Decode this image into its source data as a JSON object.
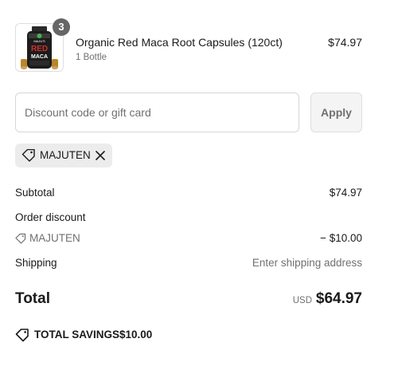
{
  "product": {
    "name": "Organic Red Maca Root Capsules (120ct)",
    "variant": "1 Bottle",
    "price": "$74.97",
    "quantity": "3",
    "image_icon": "supplement-bottle",
    "image_brand": "MAJU'S",
    "image_title_top": "RED",
    "image_title_bottom": "MACA"
  },
  "discount": {
    "placeholder": "Discount code or gift card",
    "value": "",
    "apply_label": "Apply"
  },
  "applied_code": {
    "code": "MAJUTEN",
    "icon": "tag-icon",
    "remove_icon": "close-icon"
  },
  "summary": {
    "subtotal_label": "Subtotal",
    "subtotal_value": "$74.97",
    "order_discount_label": "Order discount",
    "discount_code": "MAJUTEN",
    "discount_value": "− $10.00",
    "shipping_label": "Shipping",
    "shipping_value": "Enter shipping address",
    "total_label": "Total",
    "currency": "USD",
    "total_value": "$64.97",
    "savings_label": "TOTAL SAVINGS",
    "savings_value": "$10.00"
  },
  "colors": {
    "text": "#1a1a1a",
    "muted": "#707070",
    "border": "#d6d6d6",
    "chip_bg": "#ececec",
    "badge_bg": "#666666"
  }
}
